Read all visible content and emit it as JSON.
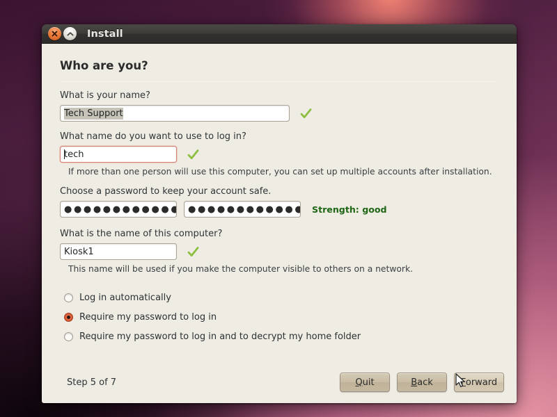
{
  "window": {
    "title": "Install",
    "titlebar_buttons": [
      {
        "name": "close",
        "icon": "close-icon"
      },
      {
        "name": "restore",
        "icon": "chevron-up-icon"
      }
    ]
  },
  "page": {
    "title": "Who are you?"
  },
  "fields": {
    "full_name": {
      "label": "What is your name?",
      "value": "Tech Support",
      "selected": true,
      "valid_icon": "green-check-icon"
    },
    "username": {
      "label": "What name do you want to use to log in?",
      "value": "tech",
      "focused": true,
      "valid_icon": "green-check-icon",
      "hint": "If more than one person will use this computer, you can set up multiple accounts after installation."
    },
    "password": {
      "label": "Choose a password to keep your account safe.",
      "value": "●●●●●●●●●●●●",
      "confirm_value": "●●●●●●●●●●●●",
      "strength_label": "Strength: good",
      "strength_color": "#1f6614"
    },
    "hostname": {
      "label": "What is the name of this computer?",
      "value": "Kiosk1",
      "valid_icon": "green-check-icon",
      "hint": "This name will be used if you make the computer visible to others on a network."
    }
  },
  "login_options": [
    {
      "label": "Log in automatically",
      "checked": false
    },
    {
      "label": "Require my password to log in",
      "checked": true
    },
    {
      "label": "Require my password to log in and to decrypt my home folder",
      "checked": false
    }
  ],
  "footer": {
    "step_text": "Step 5 of 7",
    "buttons": [
      {
        "label": "Quit",
        "mnemonic": "Q",
        "rest": "uit",
        "hover": false
      },
      {
        "label": "Back",
        "mnemonic": "B",
        "rest": "ack",
        "hover": false
      },
      {
        "label": "Forward",
        "mnemonic": "F",
        "rest": "orward",
        "hover": true
      }
    ]
  },
  "colors": {
    "accent_orange": "#e2633c",
    "check_green": "#8cbe3f",
    "window_bg": "#efece4",
    "titlebar": "#3a3835"
  }
}
